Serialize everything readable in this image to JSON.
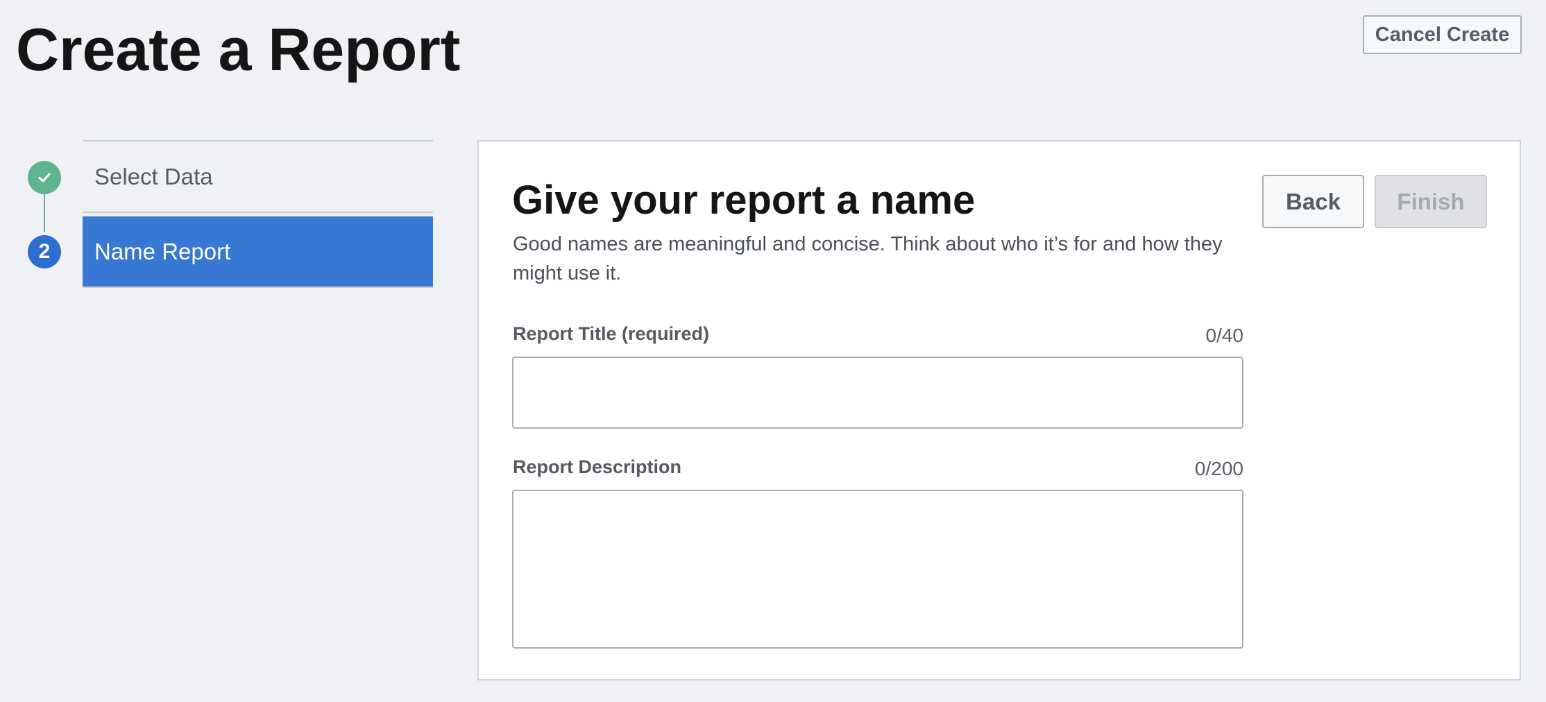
{
  "header": {
    "title": "Create a Report",
    "cancel_label": "Cancel Create"
  },
  "steps": [
    {
      "label": "Select Data",
      "status": "complete",
      "icon": "check-icon"
    },
    {
      "label": "Name Report",
      "status": "current",
      "number": "2"
    }
  ],
  "card": {
    "title": "Give your report a name",
    "description": "Good names are meaningful and concise. Think about who it’s for and how they might use it.",
    "back_label": "Back",
    "finish_label": "Finish",
    "fields": {
      "title": {
        "label": "Report Title (required)",
        "count": "0/40",
        "value": ""
      },
      "description": {
        "label": "Report Description",
        "count": "0/200",
        "value": ""
      }
    }
  },
  "colors": {
    "accent": "#3778d4",
    "complete": "#5fb48f",
    "background": "#f0f1f5"
  }
}
